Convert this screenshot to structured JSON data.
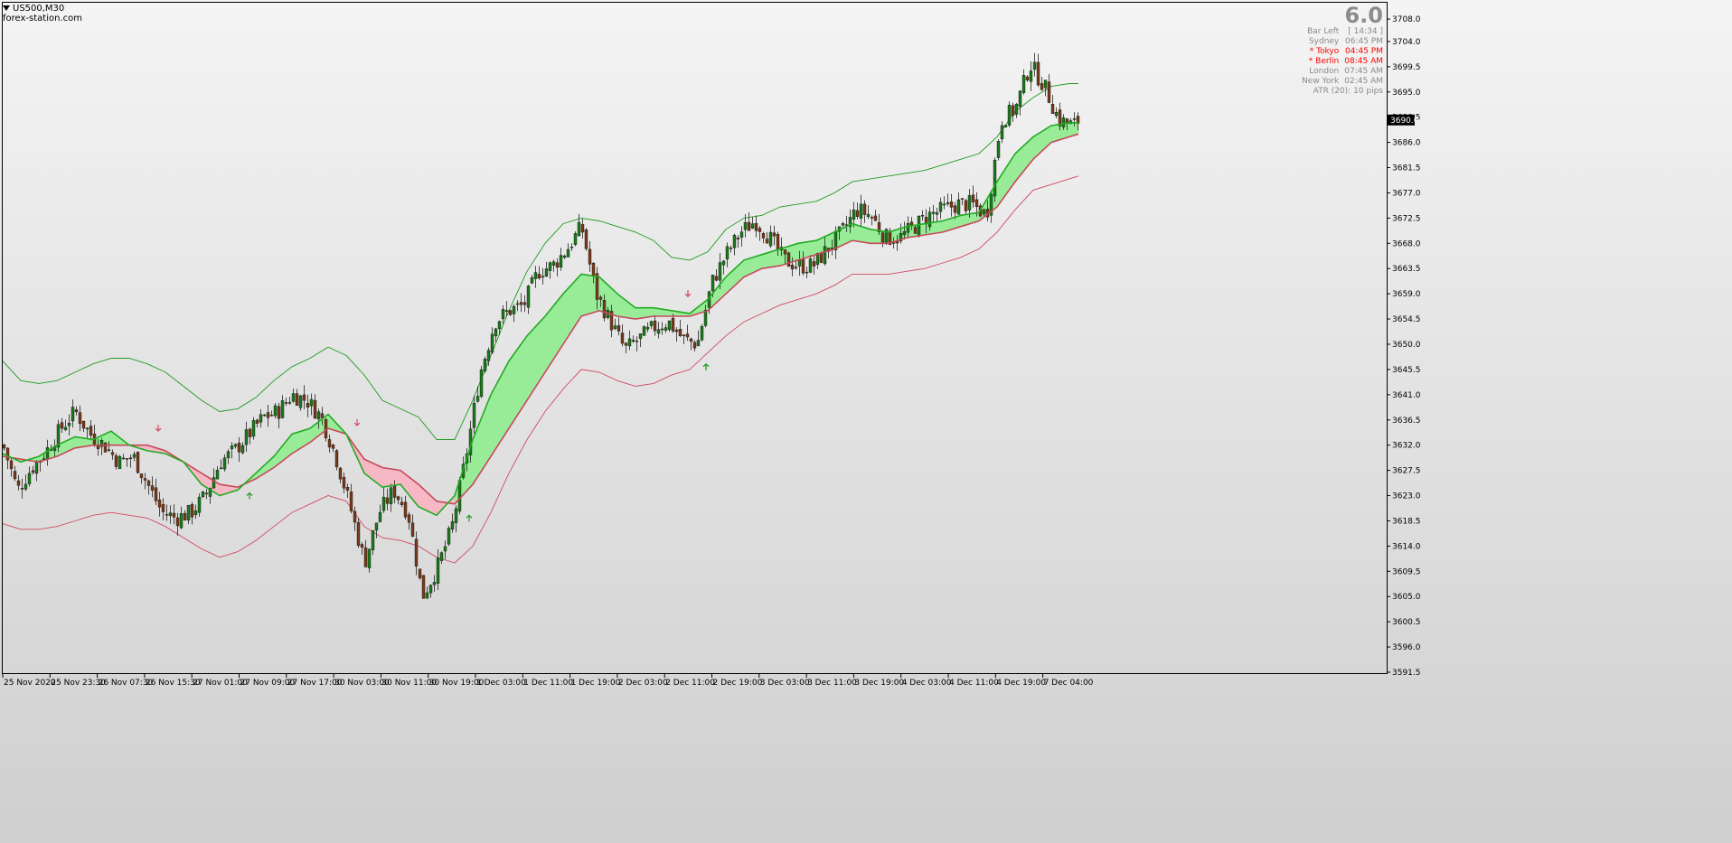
{
  "header": {
    "symbol_timeframe": "US500,M30",
    "watermark": "forex-station.com"
  },
  "info_panel": {
    "big_value": "6.0",
    "bar_left_label": "Bar Left",
    "bar_left_value": "[ 14:34 ]",
    "sessions": [
      {
        "name": "Sydney",
        "time": "06:45 PM",
        "highlight": false
      },
      {
        "name": "* Tokyo",
        "time": "04:45 PM",
        "highlight": true
      },
      {
        "name": "* Berlin",
        "time": "08:45 AM",
        "highlight": true
      },
      {
        "name": "London",
        "time": "07:45 AM",
        "highlight": false
      },
      {
        "name": "New York",
        "time": "02:45 AM",
        "highlight": false
      }
    ],
    "atr": "ATR (20): 10 pips"
  },
  "colors": {
    "background_top": "#f4f4f4",
    "background_bottom": "#cfcfcf",
    "bull_cloud": "#98ec98",
    "bear_cloud": "#f5b8c4",
    "fast_line": "#22aa22",
    "slow_line": "#c8485c",
    "upper_band": "#1e9a1e",
    "lower_band": "#d04a62",
    "candle_up": "#1a7a1a",
    "candle_down": "#7a3a1a",
    "up_arrow": "#1e9a1e",
    "down_arrow": "#d04a62",
    "price_badge_bg": "#000000"
  },
  "chart_data": {
    "type": "candlestick",
    "symbol": "US500",
    "timeframe": "M30",
    "ylim": [
      3591.5,
      3708.5
    ],
    "y_ticks": [
      3708.0,
      3704.0,
      3699.5,
      3695.0,
      3690.5,
      3686.0,
      3681.5,
      3677.0,
      3672.5,
      3668.0,
      3663.5,
      3659.0,
      3654.5,
      3650.0,
      3645.5,
      3641.0,
      3636.5,
      3632.0,
      3627.5,
      3623.0,
      3618.5,
      3614.0,
      3609.5,
      3605.0,
      3600.5,
      3596.0,
      3591.5
    ],
    "y_tick_labels": [
      "3708.0",
      "3704.0",
      "3699.5",
      "3695.0",
      "3690.5",
      "3686.0",
      "3681.5",
      "3677.0",
      "3672.5",
      "3668.0",
      "3663.5",
      "3659.0",
      "3654.5",
      "3650.0",
      "3645.5",
      "3641.0",
      "3636.5",
      "3632.0",
      "3627.5",
      "3623.0",
      "3618.5",
      "3614.0",
      "3609.5",
      "3605.0",
      "3600.5",
      "3596.0",
      "3591.5"
    ],
    "current_price": "3690.0",
    "x_tick_labels": [
      "25 Nov 2020",
      "25 Nov 23:30",
      "26 Nov 07:30",
      "26 Nov 15:30",
      "27 Nov 01:00",
      "27 Nov 09:00",
      "27 Nov 17:00",
      "30 Nov 03:00",
      "30 Nov 11:00",
      "30 Nov 19:00",
      "1 Dec 03:00",
      "1 Dec 11:00",
      "1 Dec 19:00",
      "2 Dec 03:00",
      "2 Dec 11:00",
      "2 Dec 19:00",
      "3 Dec 03:00",
      "3 Dec 11:00",
      "3 Dec 19:00",
      "4 Dec 03:00",
      "4 Dec 11:00",
      "4 Dec 19:00",
      "7 Dec 04:00"
    ],
    "close_path": {
      "x": [
        0,
        16,
        32,
        48,
        64,
        80,
        96,
        112,
        128,
        144,
        160,
        176,
        192,
        208,
        224,
        240,
        256,
        272,
        288,
        304,
        320,
        336,
        352,
        368,
        384,
        400,
        416,
        432,
        448,
        464,
        480,
        496,
        512,
        528,
        544,
        560,
        576,
        592,
        608,
        624,
        640,
        656,
        672,
        688,
        704,
        720,
        736,
        752,
        768,
        784,
        800,
        816,
        832,
        848,
        864,
        880,
        896,
        912,
        928,
        944,
        960,
        976,
        992,
        1008,
        1024,
        1040,
        1056,
        1072,
        1088,
        1104,
        1120,
        1136,
        1152,
        1168,
        1184,
        1190
      ],
      "y": [
        3632.0,
        3624.0,
        3628.0,
        3631.0,
        3635.0,
        3638.0,
        3634.0,
        3632.0,
        3629.0,
        3630.0,
        3625.0,
        3620.0,
        3619.0,
        3620.0,
        3623.0,
        3629.0,
        3631.0,
        3634.0,
        3637.0,
        3638.0,
        3641.0,
        3640.0,
        3637.0,
        3630.0,
        3621.0,
        3611.0,
        3620.0,
        3624.0,
        3620.0,
        3605.0,
        3610.0,
        3617.0,
        3630.0,
        3645.0,
        3654.0,
        3656.0,
        3657.0,
        3663.0,
        3664.0,
        3667.0,
        3671.0,
        3659.0,
        3654.0,
        3649.0,
        3651.0,
        3653.0,
        3654.0,
        3651.0,
        3650.0,
        3661.0,
        3666.0,
        3670.0,
        3672.0,
        3669.0,
        3665.0,
        3664.0,
        3664.0,
        3667.0,
        3670.0,
        3674.0,
        3673.0,
        3669.0,
        3669.0,
        3671.0,
        3673.0,
        3674.0,
        3675.0,
        3675.0,
        3673.0,
        3690.0,
        3692.0,
        3700.0,
        3696.0,
        3690.0,
        3689.0,
        3690.0
      ]
    },
    "fast_ma": {
      "x": [
        0,
        20,
        40,
        60,
        80,
        100,
        120,
        140,
        160,
        180,
        200,
        220,
        240,
        260,
        280,
        300,
        320,
        340,
        360,
        380,
        400,
        420,
        440,
        460,
        480,
        500,
        520,
        540,
        560,
        580,
        600,
        620,
        640,
        660,
        680,
        700,
        720,
        740,
        760,
        780,
        800,
        820,
        840,
        860,
        880,
        900,
        920,
        940,
        960,
        980,
        1000,
        1020,
        1040,
        1060,
        1080,
        1100,
        1120,
        1140,
        1160,
        1180,
        1190
      ],
      "y": [
        3630.5,
        3629.0,
        3630.0,
        3632.0,
        3633.5,
        3633.0,
        3634.5,
        3632.0,
        3631.0,
        3630.5,
        3629.0,
        3625.0,
        3623.0,
        3624.0,
        3627.0,
        3630.0,
        3634.0,
        3635.0,
        3637.5,
        3634.0,
        3627.0,
        3624.5,
        3625.0,
        3621.0,
        3619.5,
        3623.0,
        3633.0,
        3641.0,
        3647.0,
        3651.5,
        3655.0,
        3659.0,
        3662.5,
        3662.0,
        3659.0,
        3656.5,
        3656.5,
        3656.0,
        3655.5,
        3658.0,
        3662.0,
        3665.0,
        3666.0,
        3667.0,
        3668.0,
        3668.5,
        3670.0,
        3671.5,
        3670.5,
        3670.0,
        3671.0,
        3671.5,
        3672.0,
        3673.0,
        3673.5,
        3679.0,
        3684.0,
        3687.0,
        3689.0,
        3689.5,
        3689.5
      ]
    },
    "slow_ma": {
      "x": [
        0,
        20,
        40,
        60,
        80,
        100,
        120,
        140,
        160,
        180,
        200,
        220,
        240,
        260,
        280,
        300,
        320,
        340,
        360,
        380,
        400,
        420,
        440,
        460,
        480,
        500,
        520,
        540,
        560,
        580,
        600,
        620,
        640,
        660,
        680,
        700,
        720,
        740,
        760,
        780,
        800,
        820,
        840,
        860,
        880,
        900,
        920,
        940,
        960,
        980,
        1000,
        1020,
        1040,
        1060,
        1080,
        1100,
        1120,
        1140,
        1160,
        1180,
        1190
      ],
      "y": [
        3630.0,
        3629.5,
        3629.0,
        3630.0,
        3631.5,
        3632.0,
        3632.0,
        3632.0,
        3632.0,
        3631.0,
        3629.0,
        3627.0,
        3625.0,
        3624.5,
        3626.0,
        3628.0,
        3630.5,
        3632.5,
        3635.0,
        3634.0,
        3629.5,
        3628.0,
        3627.5,
        3625.0,
        3622.0,
        3621.5,
        3625.0,
        3630.0,
        3635.0,
        3640.0,
        3645.0,
        3650.0,
        3655.0,
        3656.0,
        3655.0,
        3654.5,
        3655.0,
        3655.0,
        3655.0,
        3656.0,
        3659.0,
        3662.0,
        3663.5,
        3664.0,
        3665.0,
        3666.0,
        3667.0,
        3668.5,
        3668.0,
        3668.0,
        3669.0,
        3669.5,
        3670.0,
        3671.0,
        3672.0,
        3674.5,
        3679.0,
        3683.0,
        3686.0,
        3687.0,
        3687.5
      ]
    },
    "upper_band": {
      "x": [
        0,
        20,
        40,
        60,
        80,
        100,
        120,
        140,
        160,
        180,
        200,
        220,
        240,
        260,
        280,
        300,
        320,
        340,
        360,
        380,
        400,
        420,
        440,
        460,
        480,
        500,
        520,
        540,
        560,
        580,
        600,
        620,
        640,
        660,
        680,
        700,
        720,
        740,
        760,
        780,
        800,
        820,
        840,
        860,
        880,
        900,
        920,
        940,
        960,
        980,
        1000,
        1020,
        1040,
        1060,
        1080,
        1100,
        1120,
        1140,
        1160,
        1180,
        1190
      ],
      "y": [
        3647.0,
        3643.5,
        3643.0,
        3643.5,
        3645.0,
        3646.5,
        3647.5,
        3647.5,
        3646.5,
        3645.0,
        3642.5,
        3640.0,
        3638.0,
        3638.5,
        3640.5,
        3643.5,
        3646.0,
        3647.5,
        3649.5,
        3648.0,
        3644.5,
        3640.0,
        3638.5,
        3637.0,
        3633.0,
        3633.0,
        3640.0,
        3648.0,
        3656.0,
        3663.0,
        3668.0,
        3671.5,
        3672.5,
        3672.0,
        3671.0,
        3670.0,
        3668.5,
        3665.5,
        3665.0,
        3666.5,
        3670.5,
        3672.5,
        3673.0,
        3674.5,
        3675.0,
        3675.5,
        3677.0,
        3679.0,
        3679.5,
        3680.0,
        3680.5,
        3681.0,
        3682.0,
        3683.0,
        3684.0,
        3687.0,
        3691.5,
        3694.0,
        3696.0,
        3696.5,
        3696.5
      ]
    },
    "lower_band": {
      "x": [
        0,
        20,
        40,
        60,
        80,
        100,
        120,
        140,
        160,
        180,
        200,
        220,
        240,
        260,
        280,
        300,
        320,
        340,
        360,
        380,
        400,
        420,
        440,
        460,
        480,
        500,
        520,
        540,
        560,
        580,
        600,
        620,
        640,
        660,
        680,
        700,
        720,
        740,
        760,
        780,
        800,
        820,
        840,
        860,
        880,
        900,
        920,
        940,
        960,
        980,
        1000,
        1020,
        1040,
        1060,
        1080,
        1100,
        1120,
        1140,
        1160,
        1180,
        1190
      ],
      "y": [
        3618.0,
        3617.0,
        3617.0,
        3617.5,
        3618.5,
        3619.5,
        3620.0,
        3619.5,
        3619.0,
        3617.5,
        3615.5,
        3613.5,
        3612.0,
        3613.0,
        3615.0,
        3617.5,
        3620.0,
        3621.5,
        3623.0,
        3622.0,
        3617.5,
        3615.5,
        3615.0,
        3614.0,
        3612.0,
        3611.0,
        3614.0,
        3620.0,
        3627.0,
        3633.0,
        3638.0,
        3642.0,
        3645.5,
        3645.0,
        3643.5,
        3642.5,
        3643.0,
        3644.5,
        3645.5,
        3648.5,
        3651.5,
        3654.0,
        3655.5,
        3657.0,
        3658.0,
        3659.0,
        3660.5,
        3662.5,
        3662.5,
        3662.5,
        3663.0,
        3663.5,
        3664.5,
        3665.5,
        3667.0,
        3670.0,
        3674.0,
        3677.5,
        3678.5,
        3679.5,
        3680.0
      ]
    },
    "signals": [
      {
        "type": "sell",
        "x": 172,
        "price": 3635.0
      },
      {
        "type": "buy",
        "x": 273,
        "price": 3623.0
      },
      {
        "type": "sell",
        "x": 392,
        "price": 3636.0
      },
      {
        "type": "buy",
        "x": 516,
        "price": 3619.0
      },
      {
        "type": "sell",
        "x": 758,
        "price": 3659.0
      },
      {
        "type": "buy",
        "x": 778,
        "price": 3646.0
      }
    ]
  }
}
